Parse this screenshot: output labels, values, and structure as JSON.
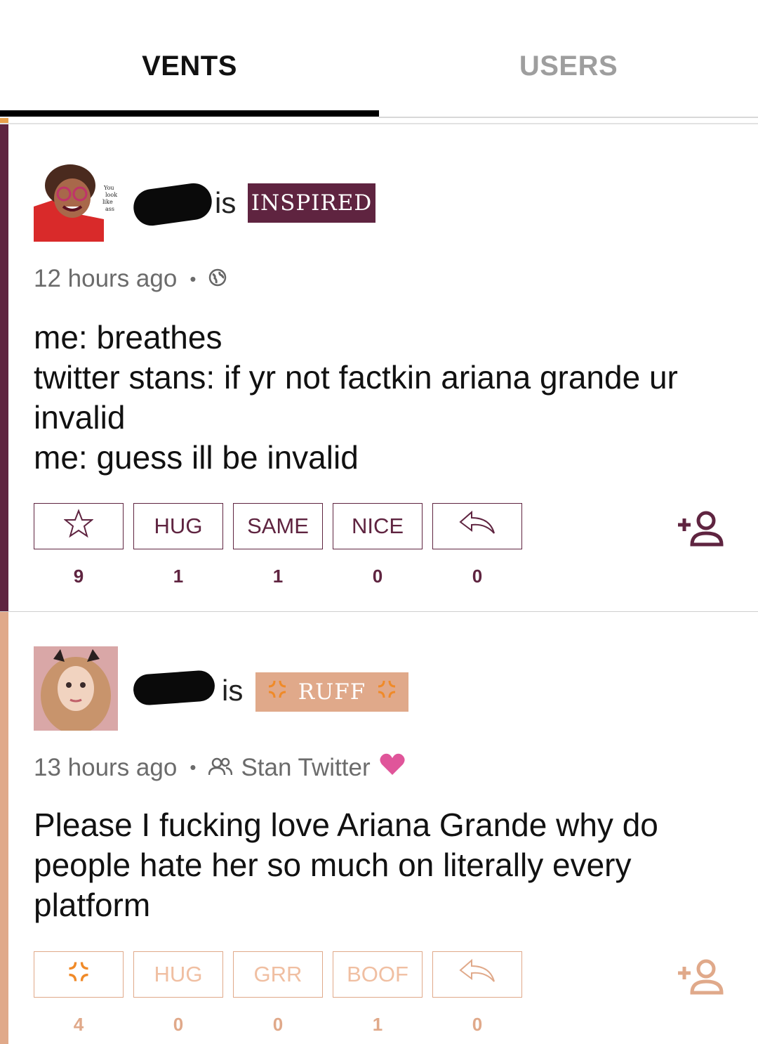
{
  "tabs": {
    "vents": "VENTS",
    "users": "USERS"
  },
  "colors": {
    "inspired": "#5f2440",
    "ruff": "#e0a98a",
    "ruff_text": "#f4c9ad",
    "heart": "#e0559a"
  },
  "posts": [
    {
      "is_word": "is",
      "mood": "INSPIRED",
      "time": "12 hours ago",
      "visibility_icon": "globe-icon",
      "lines": [
        "me: breathes",
        "twitter stans: if yr not factkin ariana grande ur",
        "invalid",
        "me: guess ill be invalid"
      ],
      "reactions": [
        {
          "label": "",
          "icon": "star-icon",
          "count": "9"
        },
        {
          "label": "HUG",
          "count": "1"
        },
        {
          "label": "SAME",
          "count": "1"
        },
        {
          "label": "NICE",
          "count": "0"
        },
        {
          "label": "",
          "icon": "reply-icon",
          "count": "0"
        }
      ],
      "avatar_text": [
        "You",
        "look",
        "like",
        "ass"
      ]
    },
    {
      "is_word": "is",
      "mood": "RUFF",
      "time": "13 hours ago",
      "community": "Stan Twitter",
      "lines": [
        "Please I fucking love Ariana Grande why do",
        "people hate her so much on literally every",
        "platform"
      ],
      "reactions": [
        {
          "label": "",
          "icon": "anger-icon",
          "count": "4"
        },
        {
          "label": "HUG",
          "count": "0"
        },
        {
          "label": "GRR",
          "count": "0"
        },
        {
          "label": "BOOF",
          "count": "1"
        },
        {
          "label": "",
          "icon": "reply-icon",
          "count": "0"
        }
      ]
    }
  ]
}
